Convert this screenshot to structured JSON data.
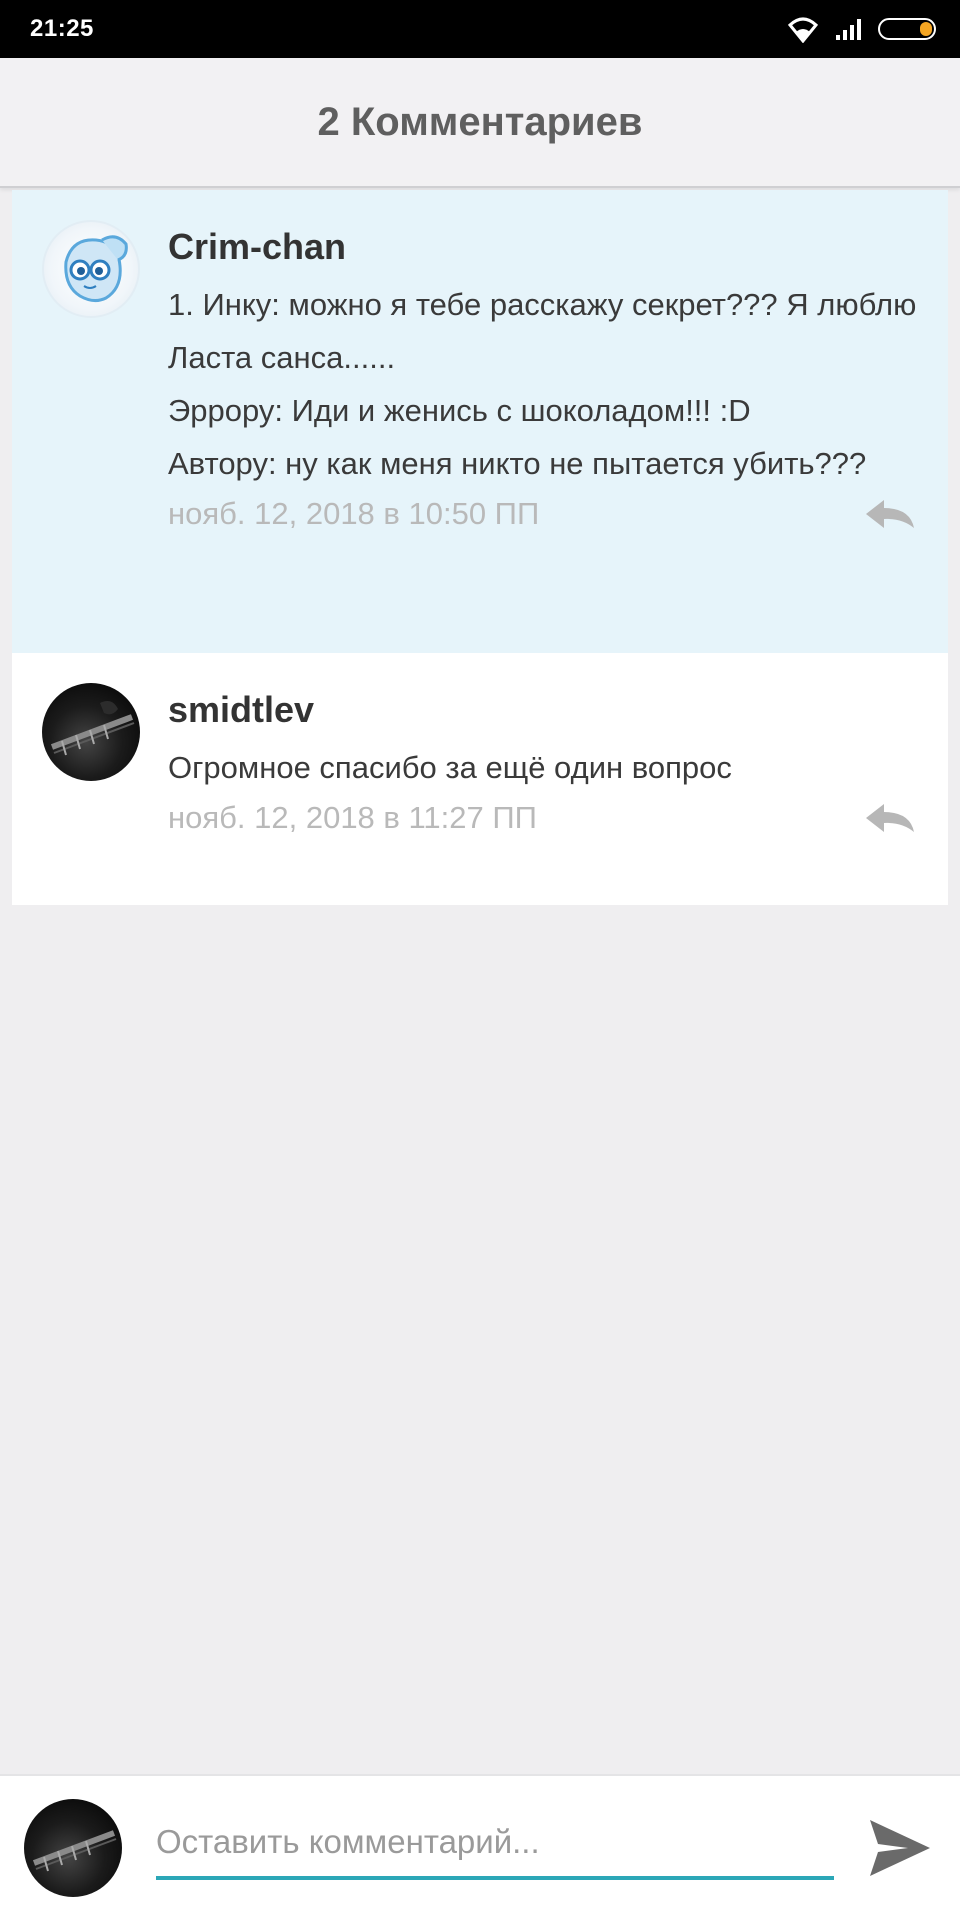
{
  "status_bar": {
    "time": "21:25"
  },
  "header": {
    "title": "2 Комментариев"
  },
  "comments": [
    {
      "author": "Crim-chan",
      "text": "1. Инку: можно я тебе расскажу секрет??? Я люблю Ласта санса......\nЭррору: Иди и женись с шоколадом!!! :D\nАвтору: ну как меня никто не пытается убить???",
      "date": "нояб. 12, 2018 в 10:50 ПП",
      "avatar": "ghost-avatar",
      "highlighted": true
    },
    {
      "author": "smidtlev",
      "text": "Огромное спасибо за ещё один вопрос",
      "date": "нояб. 12, 2018 в 11:27 ПП",
      "avatar": "guitar-avatar",
      "highlighted": false
    }
  ],
  "compose": {
    "placeholder": "Оставить комментарий...",
    "value": ""
  },
  "colors": {
    "highlight_bg": "#e6f4fa",
    "accent": "#2ba7b7",
    "date_text": "#b9b9b9",
    "battery": "#f5a623"
  }
}
